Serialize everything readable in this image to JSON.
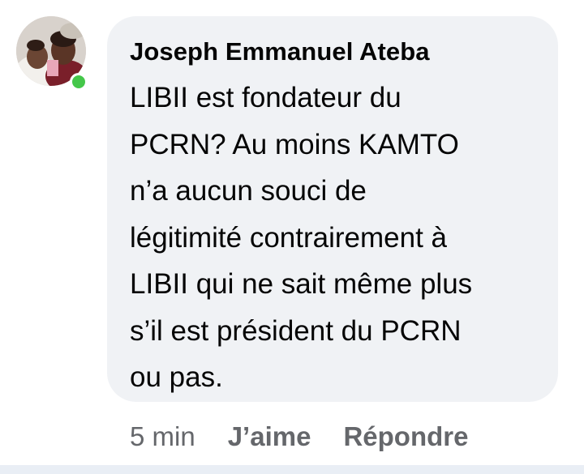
{
  "comment": {
    "author": "Joseph Emmanuel Ateba",
    "lines": [
      "LIBII est fondateur du",
      "PCRN? Au moins KAMTO",
      "n’a aucun souci de",
      "légitimité contrairement à",
      "LIBII qui ne sait même plus",
      "s’il est président du PCRN",
      "ou pas."
    ],
    "time": "5 min",
    "like_label": "J’aime",
    "reply_label": "Répondre"
  },
  "colors": {
    "bubble": "#f0f2f5",
    "online": "#44c74a",
    "meta": "#65676b",
    "text": "#050505"
  }
}
